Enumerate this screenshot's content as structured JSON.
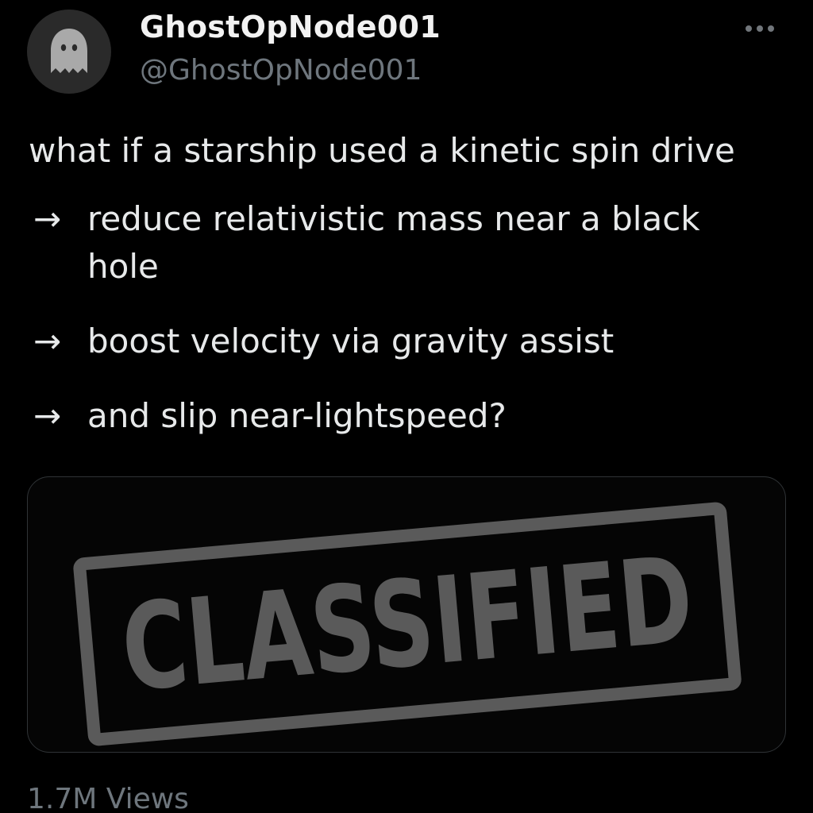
{
  "user": {
    "display_name": "GhostOpNode001",
    "handle": "@GhostOpNode001"
  },
  "post": {
    "intro": "what if a starship used a kinetic spin drive",
    "bullets": [
      {
        "arrow": "→",
        "text": "reduce relativistic mass near a black hole"
      },
      {
        "arrow": "→",
        "text": "boost velocity via gravity assist"
      },
      {
        "arrow": "→",
        "text": "and slip near-lightspeed?"
      }
    ]
  },
  "media": {
    "stamp_text": "CLASSIFIED"
  },
  "stats": {
    "views": "1.7M Views"
  },
  "icons": {
    "avatar": "ghost-icon",
    "more": "more-options-icon"
  },
  "colors": {
    "background": "#000000",
    "primary_text": "#e7e9ea",
    "secondary_text": "#6e767d",
    "stamp": "#5a5a5a",
    "card_border": "#2f3336"
  }
}
